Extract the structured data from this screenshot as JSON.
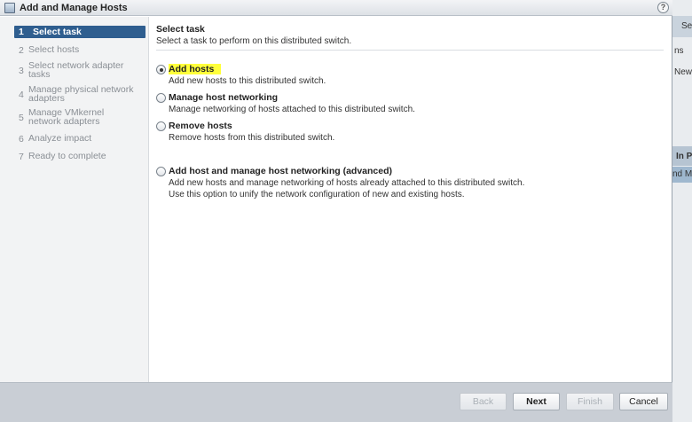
{
  "window": {
    "title": "Add and Manage Hosts",
    "help_label": "?"
  },
  "nav": {
    "steps": [
      {
        "num": "1",
        "label": "Select task"
      },
      {
        "num": "2",
        "label": "Select hosts"
      },
      {
        "num": "3",
        "label": "Select network adapter tasks"
      },
      {
        "num": "4",
        "label": "Manage physical network adapters"
      },
      {
        "num": "5",
        "label": "Manage VMkernel network adapters"
      },
      {
        "num": "6",
        "label": "Analyze impact"
      },
      {
        "num": "7",
        "label": "Ready to complete"
      }
    ],
    "active_step": 1
  },
  "main": {
    "title": "Select task",
    "subtitle": "Select a task to perform on this distributed switch.",
    "options": [
      {
        "label": "Add hosts",
        "description": "Add new hosts to this distributed switch.",
        "selected": true
      },
      {
        "label": "Manage host networking",
        "description": "Manage networking of hosts attached to this distributed switch.",
        "selected": false
      },
      {
        "label": "Remove hosts",
        "description": "Remove hosts from this distributed switch.",
        "selected": false
      },
      {
        "label": "Add host and manage host networking (advanced)",
        "description": "Add new hosts and manage networking of hosts already attached to this distributed switch. Use this option to unify the network configuration of new and existing hosts.",
        "selected": false
      }
    ]
  },
  "footer": {
    "back_label": "Back",
    "next_label": "Next",
    "finish_label": "Finish",
    "cancel_label": "Cancel"
  },
  "background": {
    "fragments": [
      "Se",
      "ns",
      "New",
      "In P",
      "nd M"
    ]
  },
  "colors": {
    "active_step": "#2f5e8f",
    "highlight": "#ffff3a"
  }
}
